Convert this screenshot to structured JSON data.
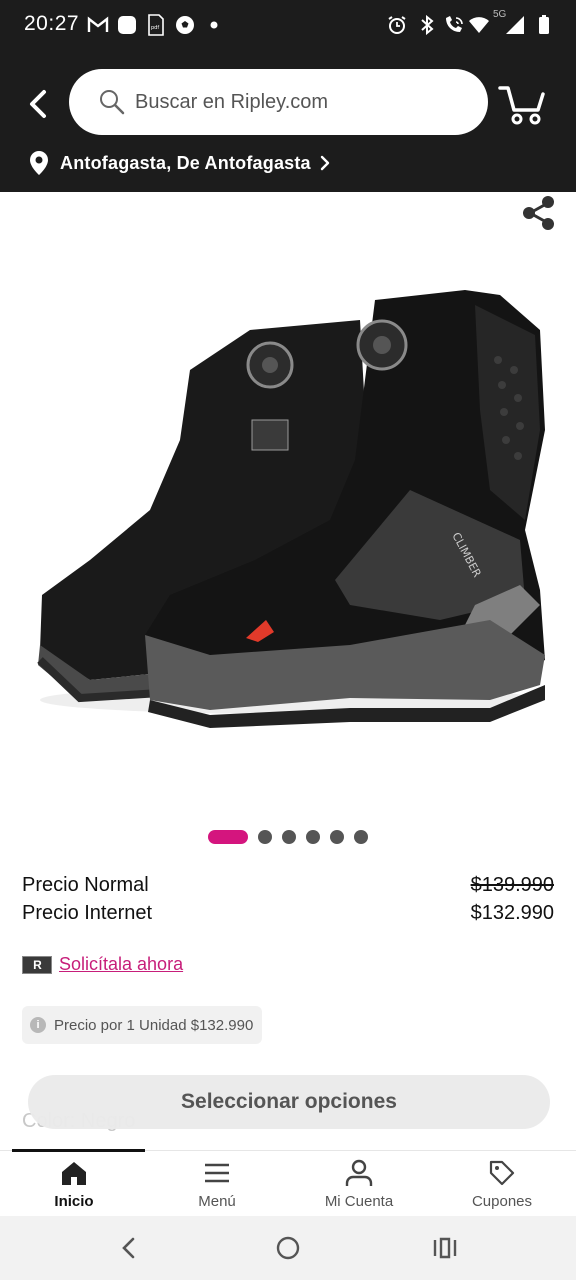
{
  "status_bar": {
    "time": "20:27",
    "network": "5G",
    "icons": [
      "gmail-icon",
      "app-icon",
      "pdf-icon",
      "soccer-ball-icon",
      "dot-icon",
      "alarm-icon",
      "bluetooth-icon",
      "wifi-calling-icon",
      "wifi-icon",
      "signal-icon",
      "battery-icon"
    ]
  },
  "header": {
    "search_placeholder": "Buscar en Ripley.com",
    "location": "Antofagasta, De Antofagasta"
  },
  "product": {
    "image_description_icon": "product-boots-image",
    "carousel": {
      "total": 6,
      "active_index": 0
    },
    "price_normal_label": "Precio Normal",
    "price_normal_value": "$139.990",
    "price_internet_label": "Precio Internet",
    "price_internet_value": "$132.990",
    "credit_logo": "R",
    "credit_link": "Solicítala ahora",
    "unit_price_text": "Precio por 1 Unidad $132.990",
    "color_label": "Color: Negro",
    "select_button": "Seleccionar opciones"
  },
  "bottom_nav": {
    "items": [
      {
        "label": "Inicio",
        "icon": "home-icon",
        "active": true
      },
      {
        "label": "Menú",
        "icon": "hamburger-icon",
        "active": false
      },
      {
        "label": "Mi Cuenta",
        "icon": "user-icon",
        "active": false
      },
      {
        "label": "Cupones",
        "icon": "tag-icon",
        "active": false
      }
    ]
  },
  "colors": {
    "header_bg": "#1c1c1c",
    "accent": "#d4157e",
    "link": "#c71e7a"
  }
}
